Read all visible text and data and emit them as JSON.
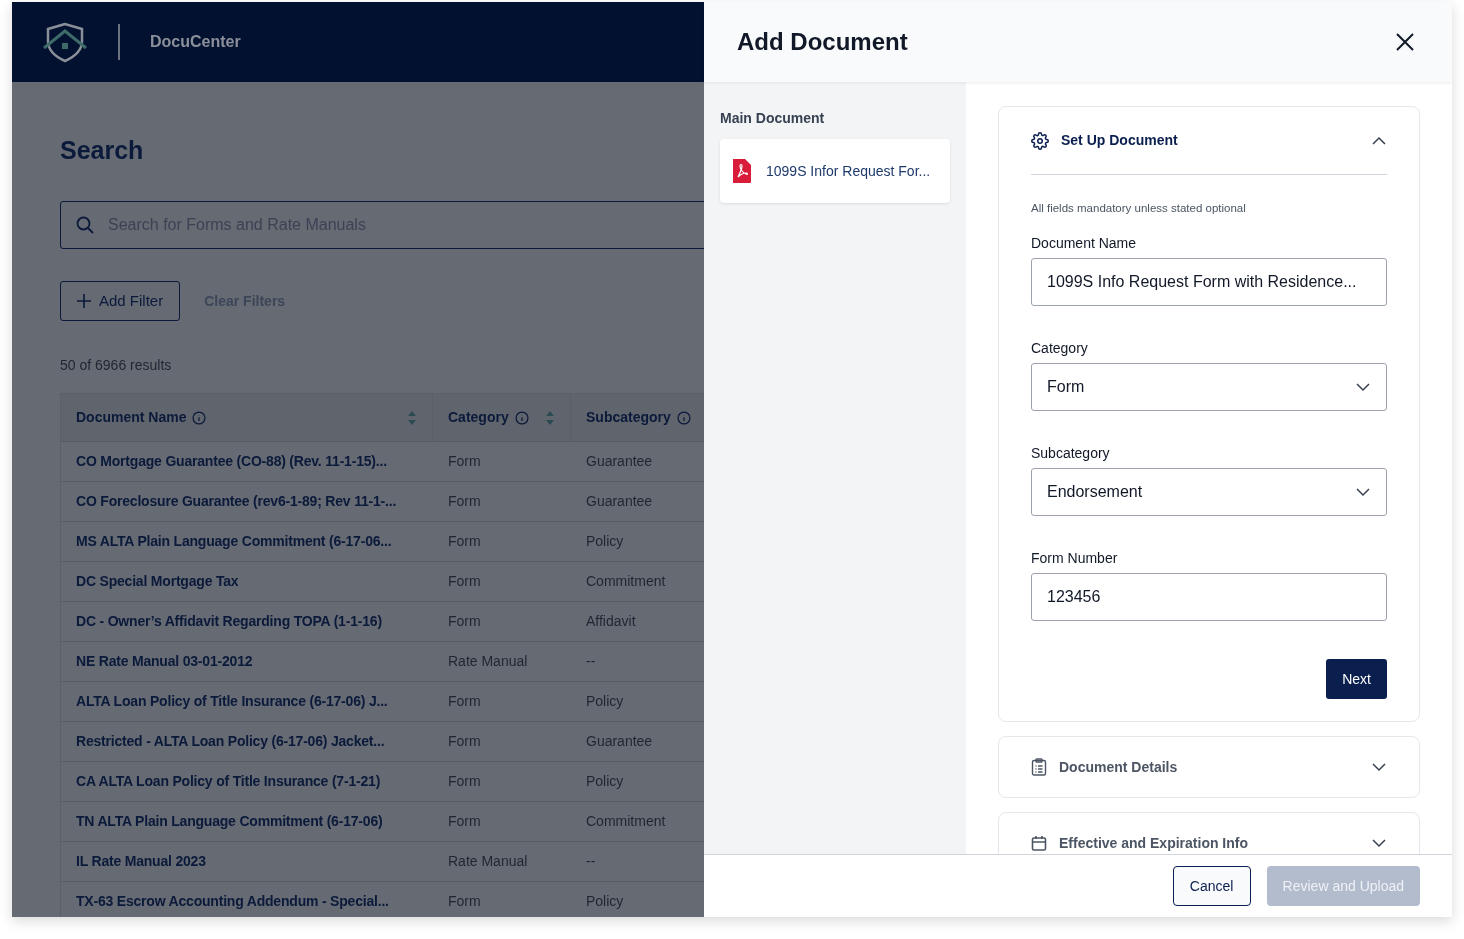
{
  "header": {
    "app_name": "DocuCenter"
  },
  "search_page": {
    "title": "Search",
    "search": {
      "placeholder": "Search for Forms and Rate Manuals"
    },
    "add_filter": "Add Filter",
    "clear_filters": "Clear Filters",
    "results_count": "50 of 6966 results",
    "table": {
      "columns": [
        {
          "label": "Document Name",
          "sortable": true
        },
        {
          "label": "Category",
          "sortable": true
        },
        {
          "label": "Subcategory"
        }
      ],
      "rows": [
        [
          "CO Mortgage Guarantee (CO-88) (Rev. 11-1-15)...",
          "Form",
          "Guarantee"
        ],
        [
          "CO Foreclosure Guarantee (rev6-1-89; Rev 11-1-...",
          "Form",
          "Guarantee"
        ],
        [
          "MS ALTA Plain Language Commitment (6-17-06...",
          "Form",
          "Policy"
        ],
        [
          "DC Special Mortgage Tax",
          "Form",
          "Commitment"
        ],
        [
          "DC - Owner’s Affidavit Regarding TOPA (1-1-16)",
          "Form",
          "Affidavit"
        ],
        [
          "NE Rate Manual 03-01-2012",
          "Rate Manual",
          "--"
        ],
        [
          "ALTA Loan Policy of Title Insurance (6-17-06) J...",
          "Form",
          "Policy"
        ],
        [
          "Restricted - ALTA Loan Policy (6-17-06) Jacket...",
          "Form",
          "Guarantee"
        ],
        [
          "CA ALTA Loan Policy of Title Insurance (7-1-21)",
          "Form",
          "Policy"
        ],
        [
          "TN ALTA Plain Language Commitment (6-17-06)",
          "Form",
          "Commitment"
        ],
        [
          "IL Rate Manual 2023",
          "Rate Manual",
          "--"
        ],
        [
          "TX-63 Escrow Accounting Addendum - Special...",
          "Form",
          "Policy"
        ]
      ]
    }
  },
  "drawer": {
    "title": "Add Document",
    "main_document": {
      "label": "Main Document",
      "file": "1099S Infor Request For..."
    },
    "sections": [
      {
        "kind": "gear",
        "title": "Set Up Document",
        "expanded": true
      },
      {
        "kind": "clipboard",
        "title": "Document Details",
        "expanded": false
      },
      {
        "kind": "calendar",
        "title": "Effective and Expiration Info",
        "expanded": false
      }
    ],
    "setup": {
      "note": "All fields mandatory unless stated optional",
      "fields": [
        {
          "kind": "text",
          "label": "Document Name",
          "value": "1099S Info Request Form with Residence..."
        },
        {
          "kind": "select",
          "label": "Category",
          "value": "Form"
        },
        {
          "kind": "select",
          "label": "Subcategory",
          "value": "Endorsement"
        },
        {
          "kind": "text",
          "label": "Form Number",
          "value": "123456"
        }
      ],
      "next": "Next"
    },
    "footer": {
      "cancel": "Cancel",
      "submit": {
        "label": "Review and Upload",
        "disabled": true
      }
    }
  }
}
